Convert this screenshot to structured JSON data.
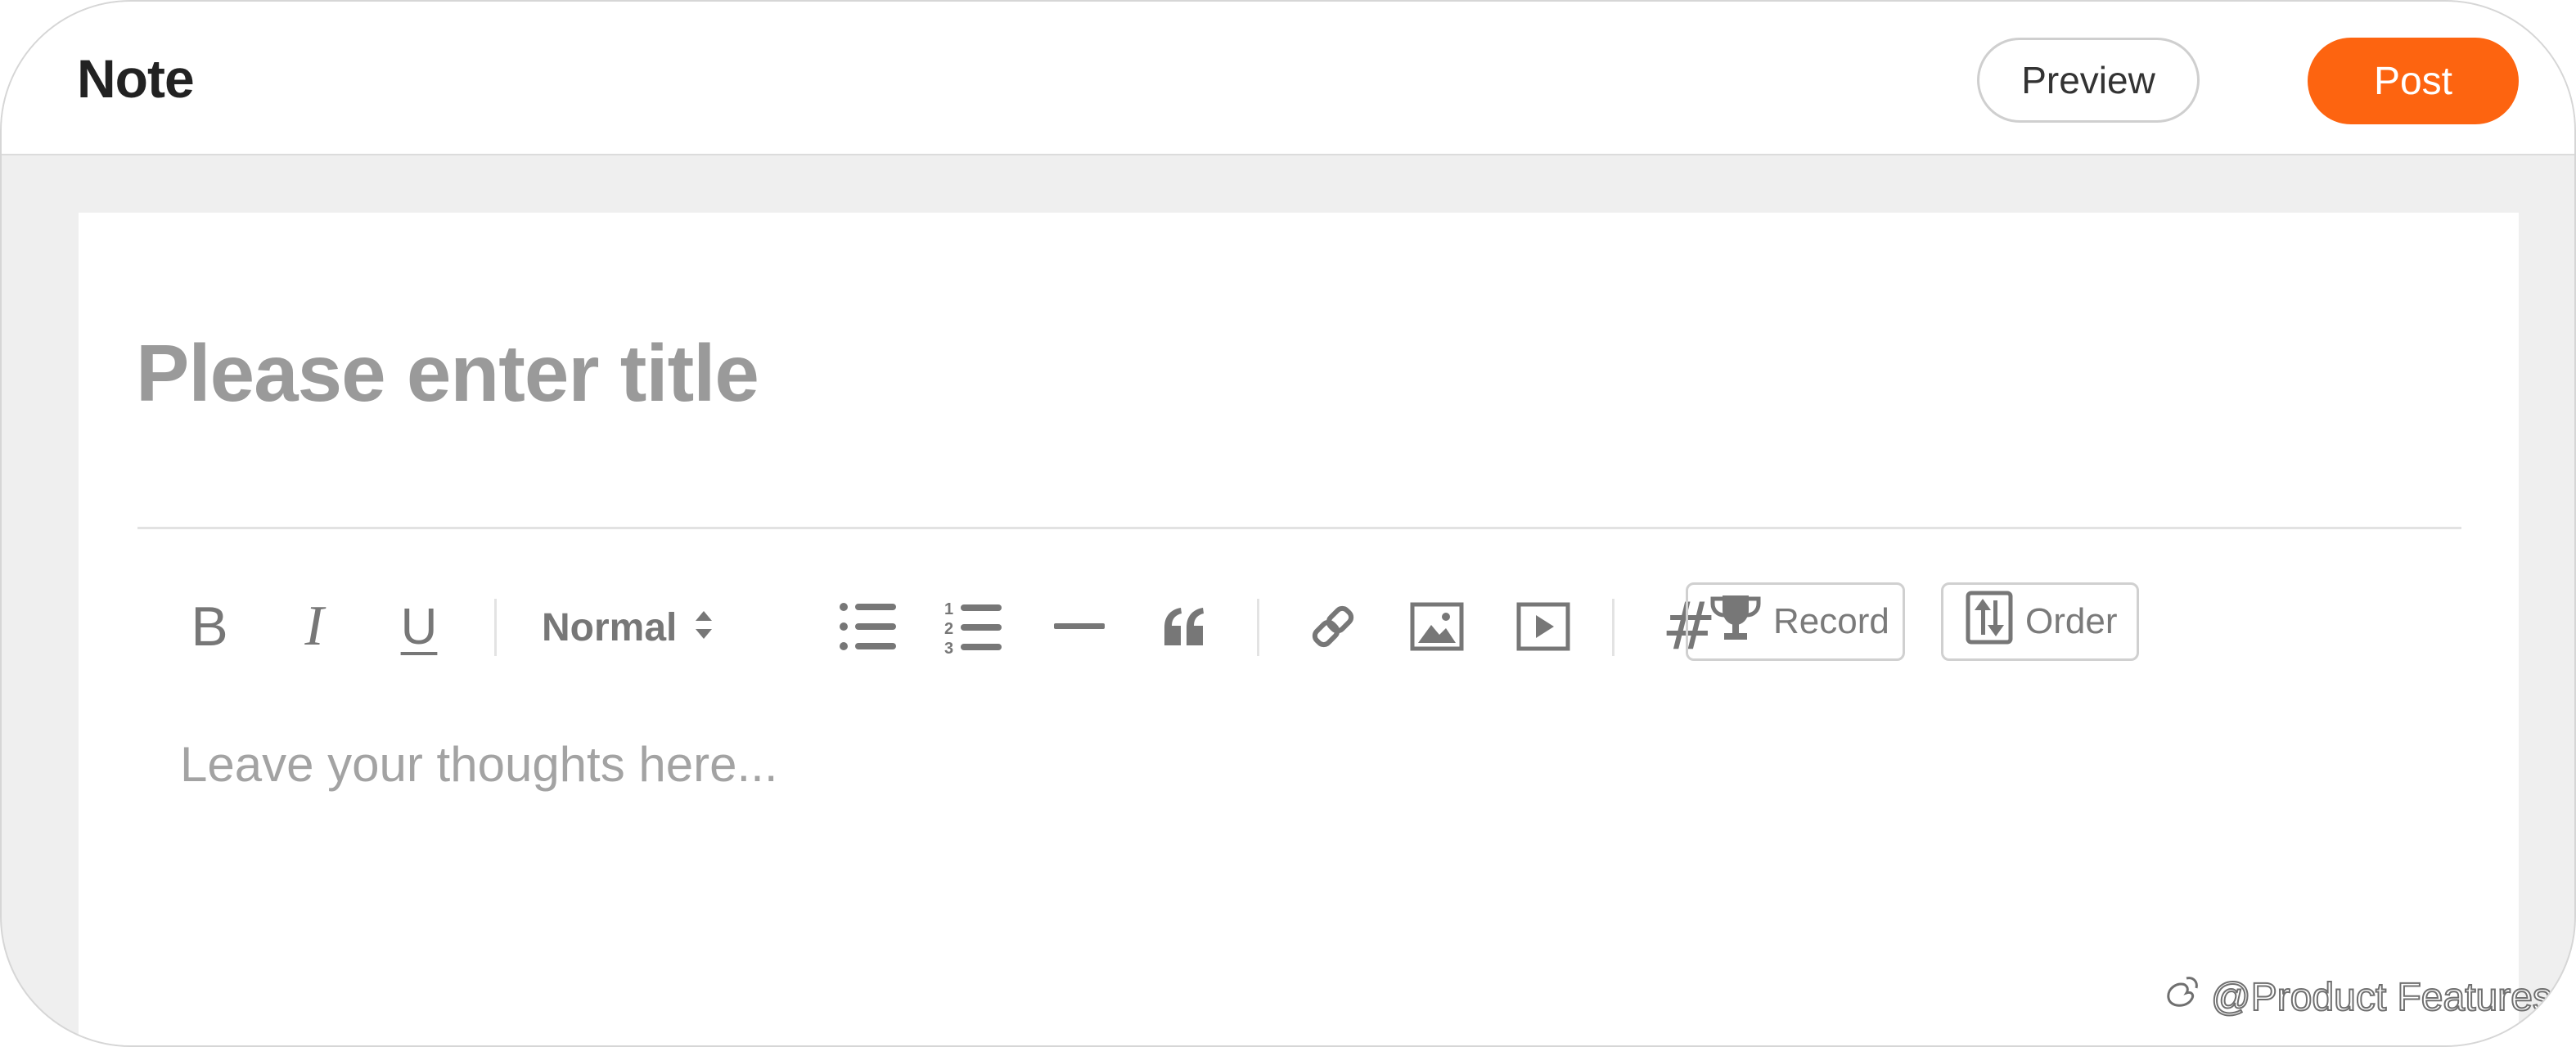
{
  "header": {
    "title": "Note",
    "preview_label": "Preview",
    "post_label": "Post",
    "accent_color": "#fd6410"
  },
  "editor": {
    "title_placeholder": "Please enter title",
    "body_placeholder": "Leave your thoughts here...",
    "toolbar": {
      "bold": "B",
      "italic": "I",
      "underline": "U",
      "format_select": "Normal",
      "hashtag": "#",
      "record_label": "Record",
      "order_label": "Order",
      "icons": [
        "bold-icon",
        "italic-icon",
        "underline-icon",
        "bullet-list-icon",
        "numbered-list-icon",
        "horizontal-rule-icon",
        "quote-icon",
        "link-icon",
        "image-icon",
        "video-icon",
        "hashtag-icon",
        "trophy-icon",
        "order-icon"
      ]
    }
  },
  "watermark": {
    "text": "@Product Features"
  }
}
